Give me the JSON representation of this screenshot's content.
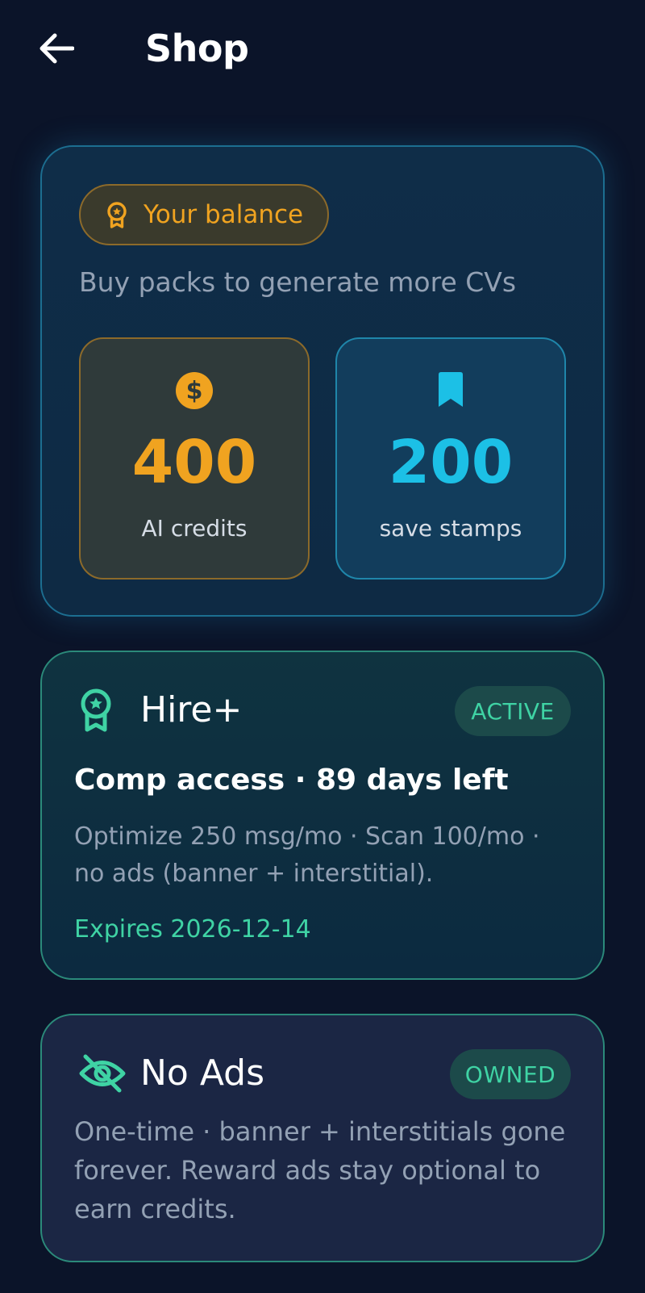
{
  "header": {
    "title": "Shop"
  },
  "balance": {
    "pill_label": "Your balance",
    "subtitle": "Buy packs to generate more CVs",
    "credits": {
      "value": "400",
      "label": "AI credits"
    },
    "stamps": {
      "value": "200",
      "label": "save stamps"
    }
  },
  "hire_plus": {
    "title": "Hire+",
    "status": "ACTIVE",
    "headline": "Comp access · 89 days left",
    "description": "Optimize 250 msg/mo · Scan 100/mo · no ads (banner + interstitial).",
    "expires": "Expires 2026-12-14"
  },
  "no_ads": {
    "title": "No Ads",
    "status": "OWNED",
    "description": "One-time · banner + interstitials gone forever. Reward ads stay optional to earn credits."
  },
  "colors": {
    "background": "#0b1429",
    "gold": "#f0a320",
    "cyan": "#1cc0e6",
    "green": "#3fd3a4"
  },
  "icons": {
    "back": "arrow-left-icon",
    "balance": "award-ribbon-icon",
    "credits": "dollar-coin-icon",
    "stamps": "bookmark-icon",
    "hire_plus": "award-ribbon-icon",
    "no_ads": "eye-off-icon"
  }
}
